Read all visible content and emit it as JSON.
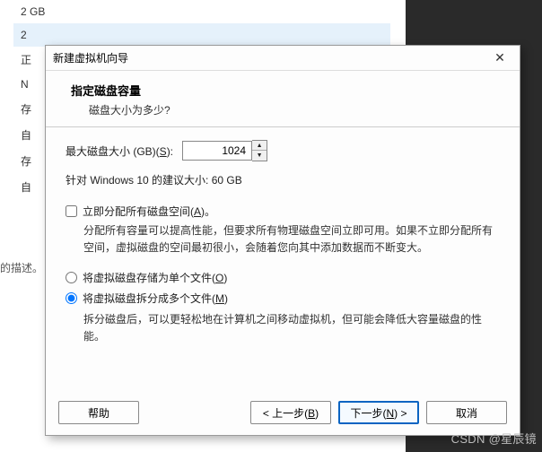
{
  "background": {
    "list_item1": "2 GB",
    "list_item2": "2",
    "list_item3": "正",
    "list_item4": "N",
    "list_item5": "存",
    "list_item6": "自",
    "list_item7": "存",
    "list_item8": "自",
    "desc": "的描述。"
  },
  "dialog": {
    "title": "新建虚拟机向导",
    "close": "✕",
    "header_title": "指定磁盘容量",
    "header_sub": "磁盘大小为多少?",
    "disk_label_pre": "最大磁盘大小 (GB)(",
    "disk_label_key": "S",
    "disk_label_post": "):",
    "disk_value": "1024",
    "recommend": "针对 Windows 10 的建议大小: 60 GB",
    "allocate_now_pre": "立即分配所有磁盘空间(",
    "allocate_now_key": "A",
    "allocate_now_post": ")。",
    "allocate_note": "分配所有容量可以提高性能，但要求所有物理磁盘空间立即可用。如果不立即分配所有空间，虚拟磁盘的空间最初很小，会随着您向其中添加数据而不断变大。",
    "radio_single_pre": "将虚拟磁盘存储为单个文件(",
    "radio_single_key": "O",
    "radio_single_post": ")",
    "radio_split_pre": "将虚拟磁盘拆分成多个文件(",
    "radio_split_key": "M",
    "radio_split_post": ")",
    "split_note": "拆分磁盘后，可以更轻松地在计算机之间移动虚拟机，但可能会降低大容量磁盘的性能。",
    "btn_help": "帮助",
    "btn_back_pre": "< 上一步(",
    "btn_back_key": "B",
    "btn_back_post": ")",
    "btn_next_pre": "下一步(",
    "btn_next_key": "N",
    "btn_next_post": ") >",
    "btn_cancel": "取消"
  },
  "watermark": "CSDN @星辰镜"
}
